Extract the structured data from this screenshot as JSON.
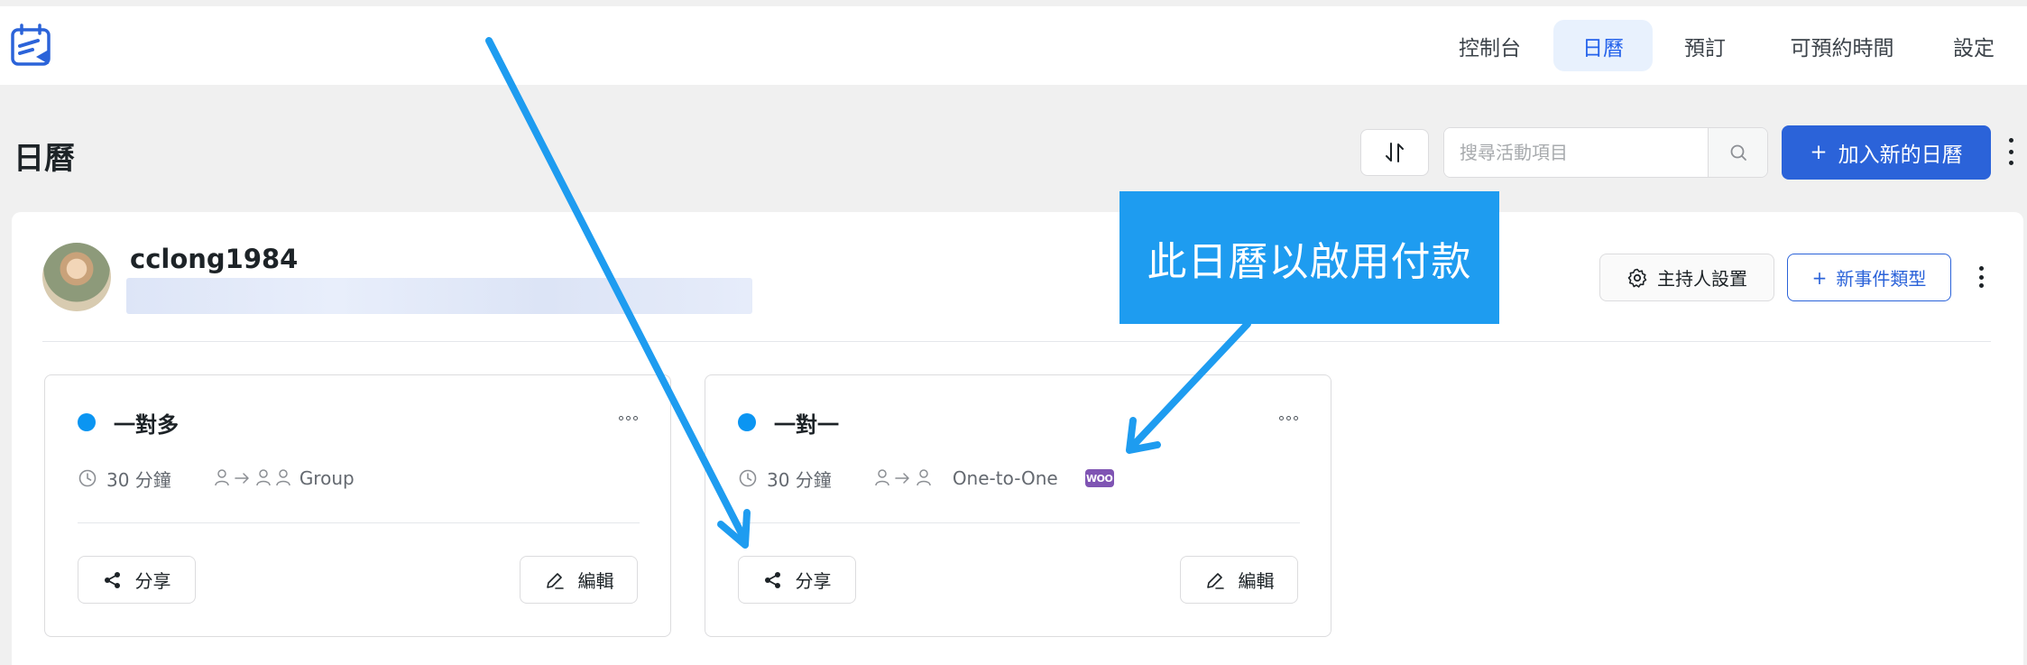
{
  "nav": {
    "items": [
      {
        "label": "控制台",
        "active": false
      },
      {
        "label": "日曆",
        "active": true
      },
      {
        "label": "預訂",
        "active": false
      },
      {
        "label": "可預約時間",
        "active": false
      },
      {
        "label": "設定",
        "active": false
      }
    ]
  },
  "page": {
    "title": "日曆"
  },
  "toolbar": {
    "search_placeholder": "搜尋活動項目",
    "add_calendar_label": "加入新的日曆",
    "plus": "+"
  },
  "host": {
    "name": "cclong1984",
    "host_settings_label": "主持人設置",
    "new_event_type_label": "新事件類型"
  },
  "events": [
    {
      "title": "一對多",
      "duration": "30 分鐘",
      "type_label": "Group",
      "share_label": "分享",
      "edit_label": "編輯",
      "payment": false
    },
    {
      "title": "一對一",
      "duration": "30 分鐘",
      "type_label": "One-to-One",
      "share_label": "分享",
      "edit_label": "編輯",
      "payment": true,
      "payment_badge": "WOO"
    }
  ],
  "annotation": {
    "callout_text": "此日曆以啟用付款"
  },
  "colors": {
    "primary": "#2b63d9",
    "nav_active_bg": "#e8f1fd",
    "event_dot": "#0b95f2",
    "callout": "#1e9cf0",
    "woo": "#7f54b3"
  }
}
